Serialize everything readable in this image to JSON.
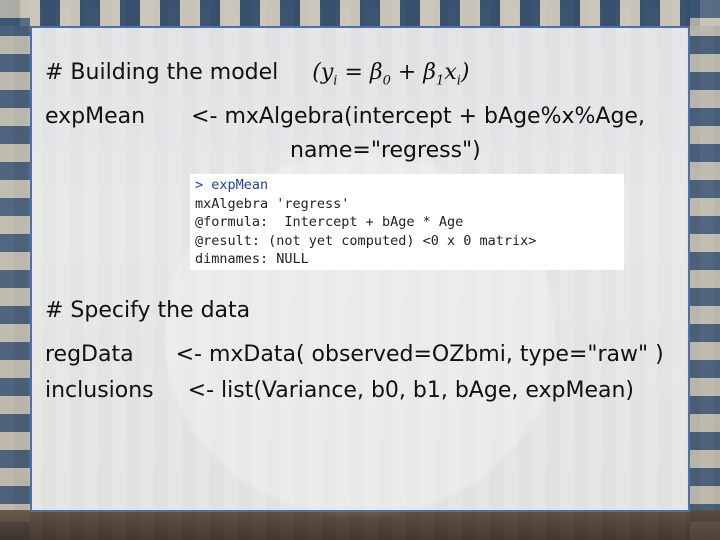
{
  "slide": {
    "heading_comment": "# Building the model",
    "heading_formula": "(y_i = β_0 + β_1 x_i)",
    "code_line1_name": "expMean",
    "code_line1_rest": "<- mxAlgebra(intercept + bAge%x%Age,",
    "code_line1_cont": "name=\"regress\")",
    "comment2": "# Specify the data",
    "line_regdata_name": "regData",
    "line_regdata_rest": "<- mxData( observed=OZbmi, type=\"raw\" )",
    "line_inclusions_name": "inclusions",
    "line_inclusions_rest": "<- list(Variance, b0,  b1, bAge, expMean)"
  },
  "console": {
    "prompt": "> expMean",
    "line2": "mxAlgebra 'regress'",
    "line3_label": "@formula:  ",
    "line3_value": "Intercept + bAge * Age",
    "line4_label": "@result: ",
    "line4_value": "(not yet computed) <0 x 0 matrix>",
    "line5_label": "dimnames: ",
    "line5_value": "NULL"
  }
}
